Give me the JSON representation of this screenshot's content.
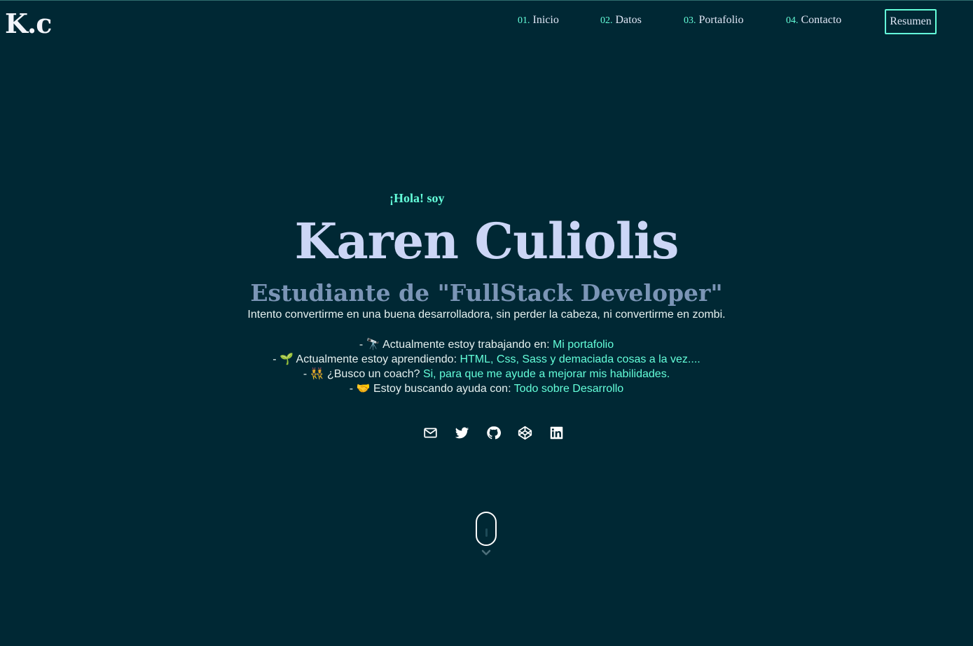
{
  "header": {
    "logo": "K.c",
    "nav": [
      {
        "num": "01.",
        "label": "Inicio"
      },
      {
        "num": "02.",
        "label": "Datos"
      },
      {
        "num": "03.",
        "label": "Portafolio"
      },
      {
        "num": "04.",
        "label": "Contacto"
      }
    ],
    "resume_label": "Resumen"
  },
  "hero": {
    "greeting": "¡Hola! soy",
    "name": "Karen Culiolis",
    "subtitle": "Estudiante de \"FullStack Developer\"",
    "intro": "Intento convertirme en una buena desarrolladora, sin perder la cabeza, ni convertirme en zombi.",
    "facts": [
      {
        "prefix": "- 🔭 Actualmente estoy trabajando en: ",
        "highlight": "Mi portafolio"
      },
      {
        "prefix": "- 🌱 Actualmente estoy aprendiendo: ",
        "highlight": "HTML, Css, Sass y demaciada cosas a la vez...."
      },
      {
        "prefix": "- 👯 ¿Busco un coach? ",
        "highlight": "Si, para que me ayude a mejorar mis habilidades."
      },
      {
        "prefix": "- 🤝 Estoy buscando ayuda con: ",
        "highlight": "Todo sobre Desarrollo"
      }
    ]
  },
  "socials": [
    {
      "icon": "mail-icon"
    },
    {
      "icon": "twitter-icon"
    },
    {
      "icon": "github-icon"
    },
    {
      "icon": "codepen-icon"
    },
    {
      "icon": "linkedin-icon"
    }
  ],
  "colors": {
    "background": "#002834",
    "accent": "#64ffda",
    "heading": "#ccd6f6",
    "subtitle": "#7b95b6"
  }
}
